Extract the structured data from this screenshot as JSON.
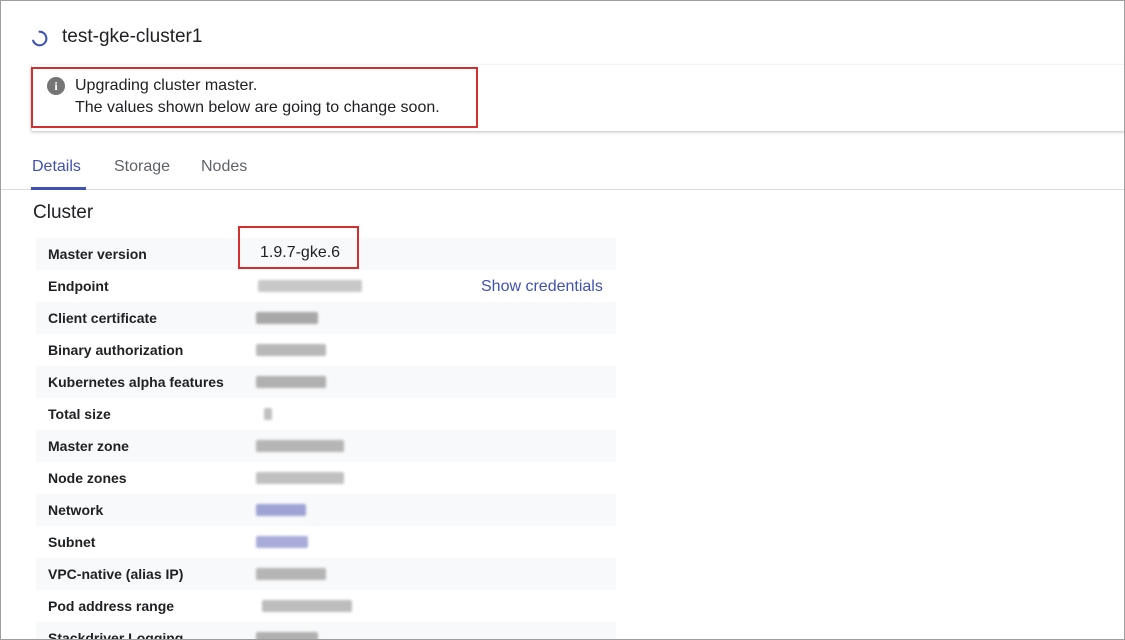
{
  "header": {
    "title": "test-gke-cluster1",
    "status_icon": "loading-spinner-icon"
  },
  "banner": {
    "icon": "info-icon",
    "line1": "Upgrading cluster master.",
    "line2": "The values shown below are going to change soon.",
    "highlight_color": "#d32f2f"
  },
  "tabs": [
    {
      "label": "Details",
      "active": true
    },
    {
      "label": "Storage",
      "active": false
    },
    {
      "label": "Nodes",
      "active": false
    }
  ],
  "section": {
    "title": "Cluster"
  },
  "details": [
    {
      "label": "Master version",
      "value": "1.9.7-gke.6"
    },
    {
      "label": "Endpoint",
      "value": "",
      "link": "Show credentials"
    },
    {
      "label": "Client certificate",
      "value": ""
    },
    {
      "label": "Binary authorization",
      "value": ""
    },
    {
      "label": "Kubernetes alpha features",
      "value": ""
    },
    {
      "label": "Total size",
      "value": ""
    },
    {
      "label": "Master zone",
      "value": ""
    },
    {
      "label": "Node zones",
      "value": ""
    },
    {
      "label": "Network",
      "value": ""
    },
    {
      "label": "Subnet",
      "value": ""
    },
    {
      "label": "VPC-native (alias IP)",
      "value": ""
    },
    {
      "label": "Pod address range",
      "value": ""
    },
    {
      "label": "Stackdriver Logging",
      "value": ""
    }
  ],
  "colors": {
    "accent": "#3f51b5",
    "annotation": "#d32f2f"
  }
}
